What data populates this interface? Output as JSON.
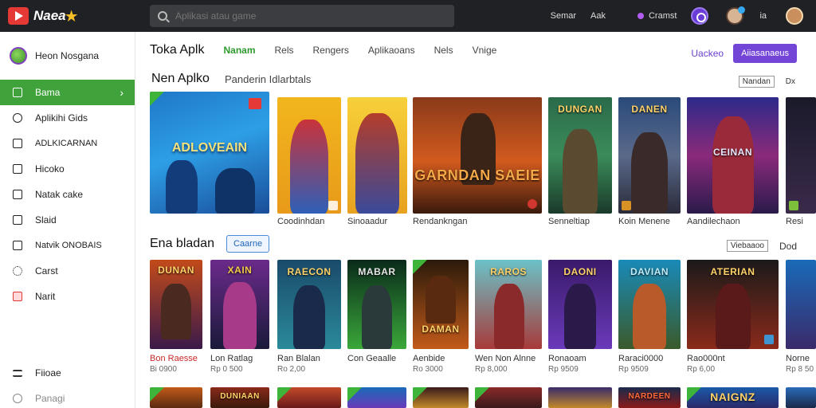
{
  "header": {
    "logo_text": "Naea",
    "search_placeholder": "Aplikasi atau game",
    "links": [
      "Semar",
      "Aak"
    ],
    "status_label": "Cramst",
    "icon_label": "ia"
  },
  "sidebar": {
    "profile_label": "Heon Nosgana",
    "items": [
      {
        "label": "Bama",
        "icon": "home-icon",
        "active": true
      },
      {
        "label": "Aplikihi Gids",
        "icon": "apps-icon"
      },
      {
        "label": "ADLKICARNAN",
        "icon": "category-icon"
      },
      {
        "label": "Hicoko",
        "icon": "book-icon"
      },
      {
        "label": "Natak cake",
        "icon": "bookmark-icon"
      },
      {
        "label": "Slaid",
        "icon": "grid-icon"
      },
      {
        "label": "Natvik ONOBAIS",
        "icon": "bag-icon"
      },
      {
        "label": "Carst",
        "icon": "gear-icon"
      },
      {
        "label": "Narit",
        "icon": "notification-icon"
      }
    ],
    "bottom_items": [
      {
        "label": "Fiioae",
        "icon": "menu-icon"
      },
      {
        "label": "Panagi",
        "icon": "help-icon"
      }
    ]
  },
  "main": {
    "store_title": "Toka Aplk",
    "tabs": [
      "Nanam",
      "Rels",
      "Rengers",
      "Aplikaoans",
      "Nels",
      "Vnige"
    ],
    "right_link": "Uackeo",
    "right_button": "Aiiasanaeus",
    "section1": {
      "title": "Nen Aplko",
      "subtitle": "Panderin Idlarbtals",
      "see_all": [
        "Nandan",
        "Dx"
      ],
      "cards": [
        {
          "caption": "",
          "art_title": "ADLOVEAIN"
        },
        {
          "caption": "Coodinhdan",
          "art_title": ""
        },
        {
          "caption": "Sinoaadur",
          "art_title": ""
        },
        {
          "caption": "Rendankngan",
          "art_title": "GARNDAN SAEIE"
        },
        {
          "caption": "Senneltiap",
          "art_title": "DUNGAN"
        },
        {
          "caption": "Koin Menene",
          "art_title": "DANEN"
        },
        {
          "caption": "Aandilechaon",
          "art_title": "CEINAN"
        },
        {
          "caption": "Resi",
          "art_title": ""
        }
      ]
    },
    "section2": {
      "title": "Ena bladan",
      "pill": "Caarne",
      "see_all": [
        "Viebaaoo",
        "Dod"
      ],
      "cards": [
        {
          "caption": "Bon Raesse",
          "price": "Bi 0900",
          "art_title": "DUNAN"
        },
        {
          "caption": "Lon Ratlag",
          "price": "Rp 0 500",
          "art_title": "XAIN"
        },
        {
          "caption": "Ran Blalan",
          "price": "Ro 2,00",
          "art_title": "RAECON"
        },
        {
          "caption": "Con Geaalle",
          "price": "",
          "art_title": "MABAR"
        },
        {
          "caption": "Aenbide",
          "price": "Ro 3000",
          "art_title": "DAMAN"
        },
        {
          "caption": "Wen Non Alnne",
          "price": "Rp 8,000",
          "art_title": "RAROS"
        },
        {
          "caption": "Ronaoam",
          "price": "Rp 9509",
          "art_title": "DAONI"
        },
        {
          "caption": "Raraci0000",
          "price": "Rp 9509",
          "art_title": "DAVIAN"
        },
        {
          "caption": "Rao000nt",
          "price": "Rp 6,00",
          "art_title": "ATERIAN"
        },
        {
          "caption": "Norne",
          "price": "Rp 8 50",
          "art_title": ""
        }
      ]
    },
    "section3": {
      "cards": [
        {
          "art_title": ""
        },
        {
          "art_title": "DUNIAAN"
        },
        {
          "art_title": ""
        },
        {
          "art_title": ""
        },
        {
          "art_title": ""
        },
        {
          "art_title": ""
        },
        {
          "art_title": ""
        },
        {
          "art_title": "NARDEEN"
        },
        {
          "art_title": "NAIGNZ"
        },
        {
          "art_title": ""
        }
      ]
    }
  },
  "colors": {
    "topbar": "#202124",
    "active_nav": "#3fa23a",
    "accent_purple": "#7446d8",
    "tab_active": "#2e9a2e"
  }
}
